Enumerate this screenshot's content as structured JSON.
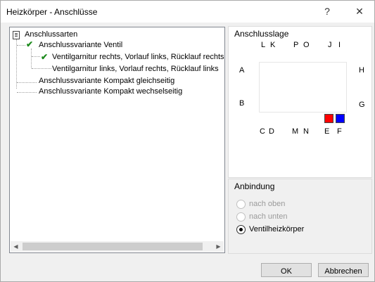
{
  "window": {
    "title": "Heizkörper - Anschlüsse"
  },
  "titlebar": {
    "help_glyph": "?",
    "close_glyph": "✕"
  },
  "tree": {
    "root": "Anschlussarten",
    "items": [
      {
        "label": "Anschlussvariante  Ventil",
        "checked": true
      },
      {
        "label": "Ventilgarnitur rechts, Vorlauf links, Rücklauf rechts",
        "checked": true,
        "selected": true
      },
      {
        "label": "Ventilgarnitur links, Vorlauf rechts, Rücklauf links",
        "checked": false
      },
      {
        "label": "Anschlussvariante  Kompakt gleichseitig",
        "checked": false
      },
      {
        "label": "Anschlussvariante Kompakt  wechselseitig",
        "checked": false
      }
    ],
    "check_glyph": "✔"
  },
  "anschlusslage": {
    "title": "Anschlusslage",
    "top": [
      "L",
      "K",
      "P",
      "O",
      "J",
      "I"
    ],
    "left": [
      "A",
      "B"
    ],
    "right": [
      "H",
      "G"
    ],
    "bottom": [
      "C",
      "D",
      "M",
      "N",
      "E",
      "F"
    ],
    "color_e": "#ff0000",
    "color_f": "#0000ff"
  },
  "anbindung": {
    "title": "Anbindung",
    "options": [
      {
        "label": "nach oben",
        "enabled": false,
        "checked": false
      },
      {
        "label": "nach unten",
        "enabled": false,
        "checked": false
      },
      {
        "label": "Ventilheizkörper",
        "enabled": true,
        "checked": true
      }
    ]
  },
  "buttons": {
    "ok": "OK",
    "cancel": "Abbrechen"
  }
}
